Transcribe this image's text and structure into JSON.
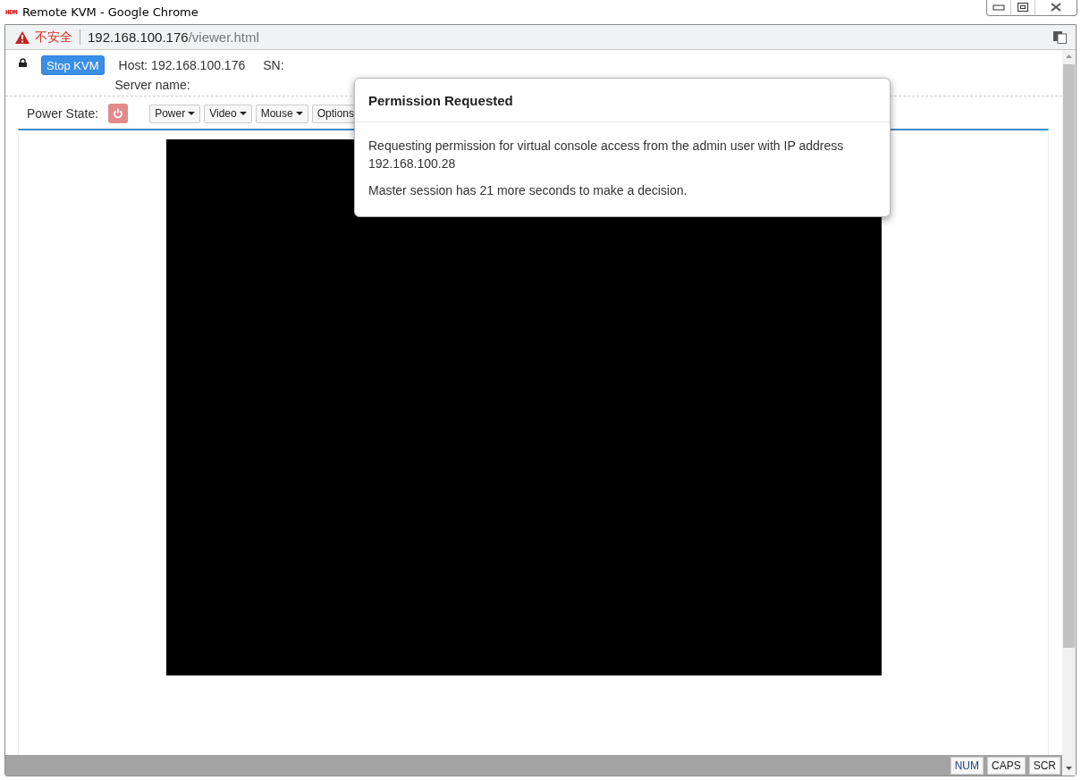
{
  "window": {
    "icon_text": "HDM",
    "title": "Remote KVM - Google Chrome"
  },
  "address_bar": {
    "security": "不安全",
    "host": "192.168.100.176",
    "path": "/viewer.html"
  },
  "header": {
    "stop_button": "Stop KVM",
    "host": "Host: 192.168.100.176",
    "sn": "SN:",
    "server_name": "Server name:"
  },
  "toolbar": {
    "power_state_label": "Power State:",
    "power_on": false,
    "menus": [
      {
        "label": "Power"
      },
      {
        "label": "Video"
      },
      {
        "label": "Mouse"
      },
      {
        "label": "Options"
      }
    ]
  },
  "dialog": {
    "title": "Permission Requested",
    "message": "Requesting permission for virtual console access from the admin user with IP address 192.168.100.28",
    "countdown": "Master session has 21 more seconds to make a decision."
  },
  "status_bar": {
    "keys": [
      {
        "label": "NUM",
        "on": true
      },
      {
        "label": "CAPS",
        "on": false
      },
      {
        "label": "SCR",
        "on": false
      }
    ]
  }
}
